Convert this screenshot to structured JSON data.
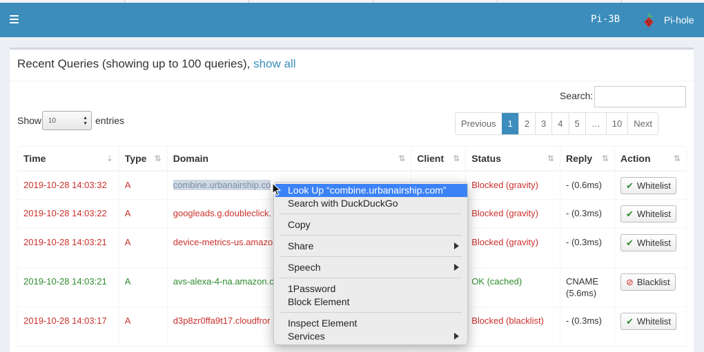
{
  "header": {
    "hostname": "Pi-3B",
    "brand": "Pi-hole"
  },
  "box": {
    "title": "Recent Queries (showing up to 100 queries), ",
    "show_all": "show all"
  },
  "controls": {
    "search_label": "Search:",
    "show_label": "Show",
    "entries_value": "10",
    "entries_label": "entries"
  },
  "pagination": [
    "Previous",
    "1",
    "2",
    "3",
    "4",
    "5",
    "…",
    "10",
    "Next"
  ],
  "table": {
    "columns": [
      "Time",
      "Type",
      "Domain",
      "Client",
      "Status",
      "Reply",
      "Action"
    ],
    "rows": [
      {
        "time": "2019-10-28 14:03:32",
        "type": "A",
        "domain": "combine.urbanairship.co",
        "status": "Blocked (gravity)",
        "reply": "- (0.6ms)",
        "action": "Whitelist"
      },
      {
        "time": "2019-10-28 14:03:22",
        "type": "A",
        "domain": "googleads.g.doubleclick.",
        "status": "Blocked (gravity)",
        "reply": "- (0.3ms)",
        "action": "Whitelist"
      },
      {
        "time": "2019-10-28 14:03:21",
        "type": "A",
        "domain": "device-metrics-us.amazo",
        "status": "Blocked (gravity)",
        "reply": "- (0.3ms)",
        "action": "Whitelist"
      },
      {
        "time": "2019-10-28 14:03:21",
        "type": "A",
        "domain": "avs-alexa-4-na.amazon.c",
        "status": "OK (cached)",
        "reply": "CNAME",
        "reply2": "(5.6ms)",
        "action": "Blacklist"
      },
      {
        "time": "2019-10-28 14:03:17",
        "type": "A",
        "domain": "d3p8zr0ffa9t17.cloudfror",
        "status": "Blocked (blacklist)",
        "reply": "- (0.3ms)",
        "action": "Whitelist"
      }
    ]
  },
  "context_menu": {
    "lookup": "Look Up “combine.urbanairship.com”",
    "search": "Search with DuckDuckGo",
    "copy": "Copy",
    "share": "Share",
    "speech": "Speech",
    "onepassword": "1Password",
    "block_element": "Block Element",
    "inspect": "Inspect Element",
    "services": "Services"
  },
  "colors": {
    "navbar": "#3c8dbc",
    "blocked": "#c9302c",
    "ok": "#2e8b2e",
    "menu_highlight": "#3b82f6"
  }
}
